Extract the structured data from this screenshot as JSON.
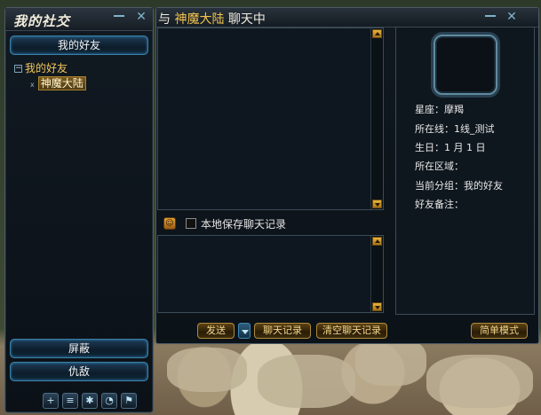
{
  "social_panel": {
    "title": "我的社交",
    "tab_friends": "我的好友",
    "group_name": "我的好友",
    "group_toggle": "−",
    "friend_name": "神魔大陆",
    "friend_marker": "x",
    "btn_block": "屏蔽",
    "btn_enemy": "仇敌",
    "bottom_icons": [
      "add-friend-icon",
      "scroll-icon",
      "settings-icon",
      "chat-bubble-icon",
      "flag-icon"
    ]
  },
  "chat": {
    "title_prefix": "与",
    "title_name": "神魔大陆",
    "title_suffix": "聊天中",
    "save_record_label": "本地保存聊天记录",
    "save_record_checked": false,
    "send": "发送",
    "history": "聊天记录",
    "clear_history": "清空聊天记录",
    "simple_mode": "简单模式"
  },
  "profile": {
    "constellation": "星座：摩羯",
    "server_line": "所在线：1线_测试",
    "birthday": "生日：1 月 1 日",
    "region": "所在区域：",
    "group": "当前分组：我的好友",
    "remark": "好友备注："
  },
  "colors": {
    "accent_gold": "#f2c44f",
    "panel_bg": "#0e171f",
    "button_blue": "#3c7fa6"
  }
}
